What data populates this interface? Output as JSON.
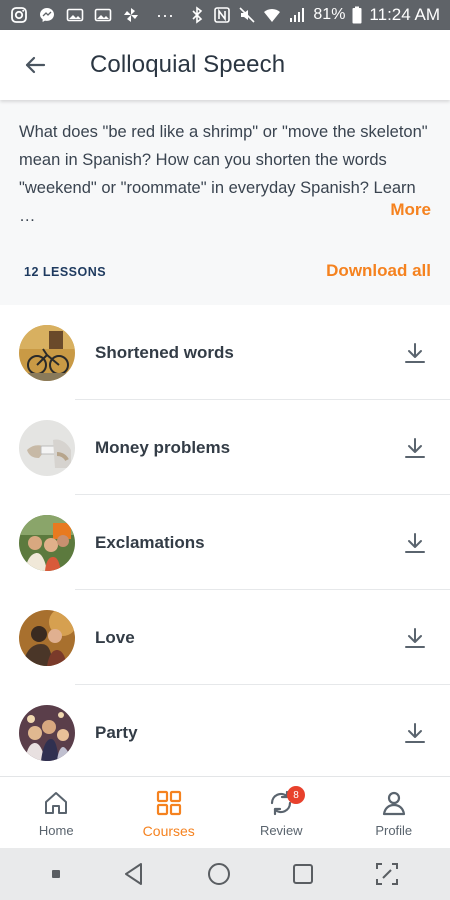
{
  "status_bar": {
    "battery": "81%",
    "time": "11:24 AM",
    "overflow": "···"
  },
  "header": {
    "title": "Colloquial Speech"
  },
  "course": {
    "description": "What does \"be red like a shrimp\" or \"move the skeleton\" mean in Spanish? How can you shorten the words \"weekend\" or \"roommate\" in everyday Spanish? Learn …",
    "more_label": "More",
    "lessons_count": "12 LESSONS",
    "download_all_label": "Download all"
  },
  "lessons": [
    {
      "title": "Shortened words",
      "thumb_color": "#b48a3c"
    },
    {
      "title": "Money problems",
      "thumb_color": "#c8c8c8"
    },
    {
      "title": "Exclamations",
      "thumb_color": "#6b8a4a"
    },
    {
      "title": "Love",
      "thumb_color": "#8a5a30"
    },
    {
      "title": "Party",
      "thumb_color": "#6a4a5a"
    }
  ],
  "bottom_nav": {
    "items": [
      {
        "label": "Home",
        "icon": "home-icon"
      },
      {
        "label": "Courses",
        "icon": "courses-grid-icon"
      },
      {
        "label": "Review",
        "icon": "review-sync-icon",
        "badge": "8"
      },
      {
        "label": "Profile",
        "icon": "profile-icon"
      }
    ],
    "active": "Courses"
  },
  "colors": {
    "accent": "#f5821f",
    "navy": "#1e3a5f",
    "badge": "#e8412c"
  }
}
